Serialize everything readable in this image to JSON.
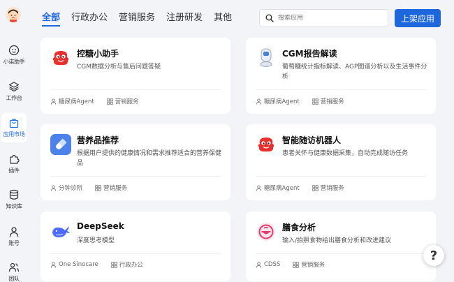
{
  "sidebar": {
    "items": [
      {
        "label": "小诺助手"
      },
      {
        "label": "工作台"
      },
      {
        "label": "应用市场"
      },
      {
        "label": "插件"
      },
      {
        "label": "知识库"
      },
      {
        "label": "账号"
      },
      {
        "label": "团队"
      }
    ]
  },
  "header": {
    "tabs": [
      {
        "label": "全部"
      },
      {
        "label": "行政办公"
      },
      {
        "label": "营销服务"
      },
      {
        "label": "注册研发"
      },
      {
        "label": "其他"
      }
    ],
    "search_placeholder": "搜索应用",
    "publish_label": "上架应用"
  },
  "cards": [
    {
      "title": "控糖小助手",
      "desc": "CGM数据分析与售后问题答疑",
      "tags": [
        "糖尿病Agent",
        "营销服务"
      ]
    },
    {
      "title": "CGM报告解读",
      "desc": "葡萄糖统计指标解读、AGP图谱分析以及生活事件分析",
      "tags": [
        "糖尿病Agent",
        "营销服务"
      ]
    },
    {
      "title": "营养品推荐",
      "desc": "根据用户提供的健康情况和需求推荐适合的营养保健品",
      "tags": [
        "分钟诊所",
        "营销服务"
      ]
    },
    {
      "title": "智能随访机器人",
      "desc": "患者关怀与健康数据采集，自动完成随访任务",
      "tags": [
        "糖尿病Agent",
        "营销服务"
      ]
    },
    {
      "title": "DeepSeek",
      "desc": "深度思考模型",
      "tags": [
        "One Sinocare",
        "行政办公"
      ]
    },
    {
      "title": "膳食分析",
      "desc": "输入/拍照食物给出膳食分析和改进建议",
      "tags": [
        "CDSS",
        "营销服务"
      ]
    }
  ],
  "help_label": "?",
  "colors": {
    "accent": "#1e66dc",
    "background": "#f3f4f8"
  }
}
